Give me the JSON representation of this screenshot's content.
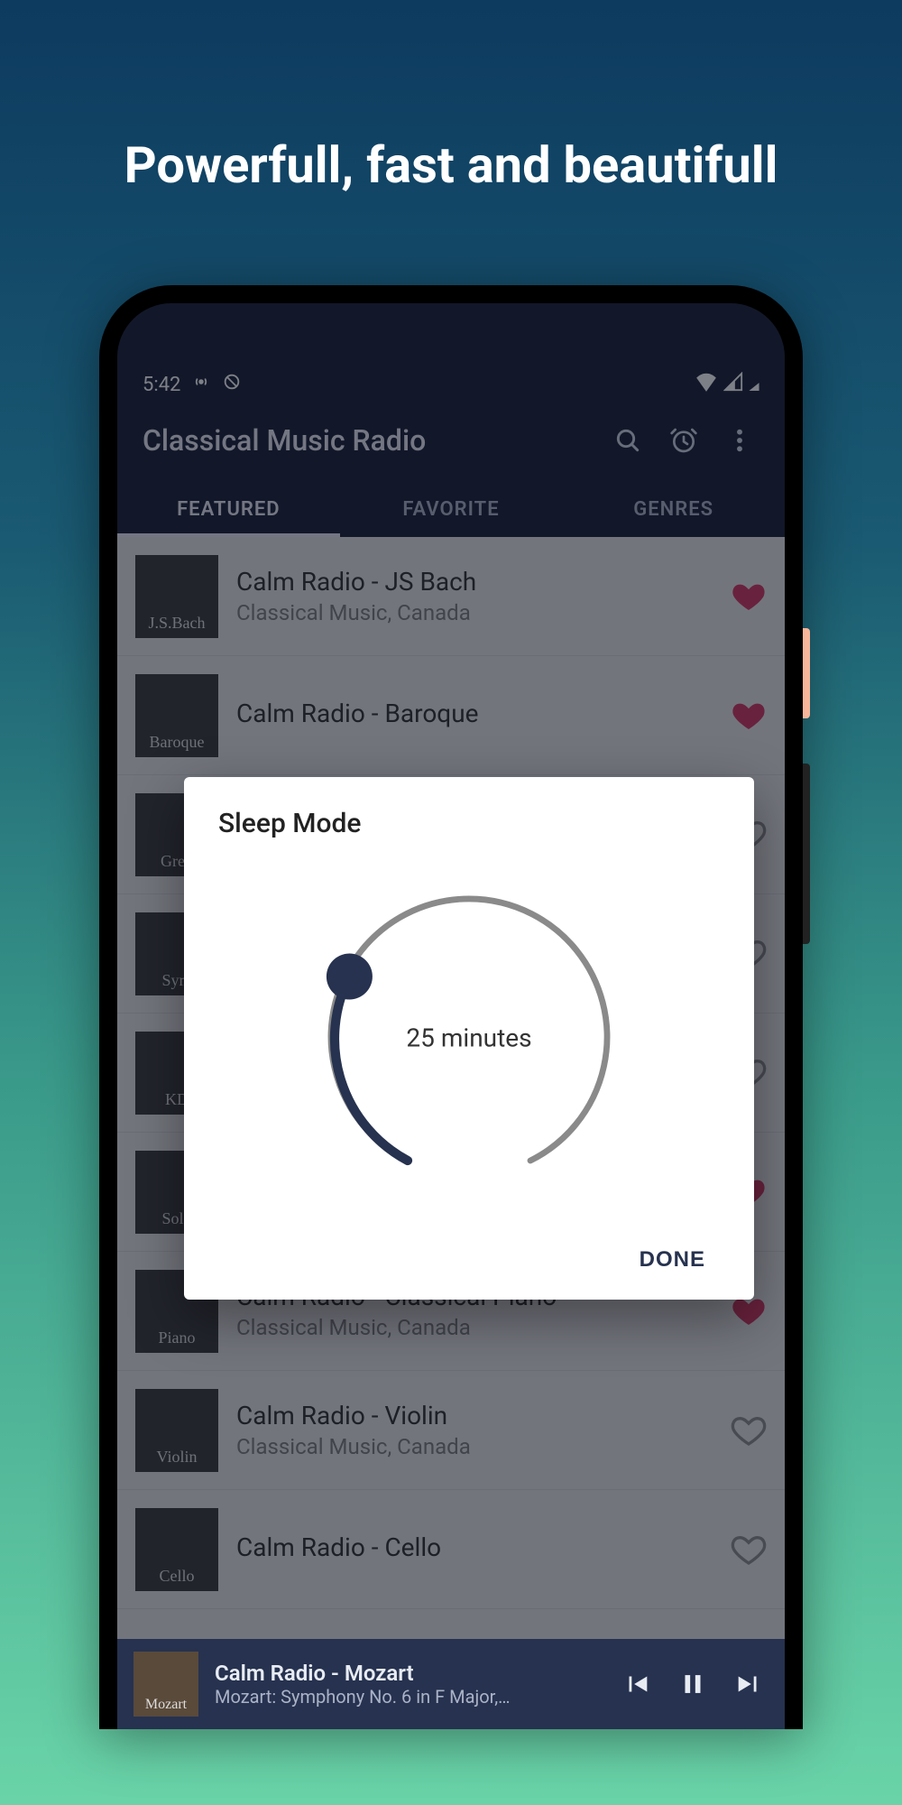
{
  "headline": "Powerfull, fast and beautifull",
  "status": {
    "time": "5:42",
    "icons_left": [
      "broadcast-icon",
      "no-location-icon"
    ],
    "icons_right": [
      "wifi-icon",
      "signal-icon",
      "battery-icon"
    ]
  },
  "app": {
    "title": "Classical Music Radio",
    "actions": [
      "search",
      "alarm",
      "more"
    ]
  },
  "tabs": [
    {
      "label": "FEATURED",
      "active": true
    },
    {
      "label": "FAVORITE",
      "active": false
    },
    {
      "label": "GENRES",
      "active": false
    }
  ],
  "stations": [
    {
      "thumb": "J.S.Bach",
      "title": "Calm Radio - JS Bach",
      "sub": "Classical Music, Canada",
      "fav": true
    },
    {
      "thumb": "Baroque",
      "title": "Calm Radio - Baroque",
      "sub": "",
      "fav": true
    },
    {
      "thumb": "Greg",
      "title": "",
      "sub": "",
      "fav": false
    },
    {
      "thumb": "Sym",
      "title": "",
      "sub": "",
      "fav": false
    },
    {
      "thumb": "KD",
      "title": "",
      "sub": "",
      "fav": false
    },
    {
      "thumb": "Solo",
      "title": "",
      "sub": "",
      "fav": true
    },
    {
      "thumb": "Piano",
      "title": "Calm Radio - Classical Piano",
      "sub": "Classical Music, Canada",
      "fav": true
    },
    {
      "thumb": "Violin",
      "title": "Calm Radio - Violin",
      "sub": "Classical Music, Canada",
      "fav": false
    },
    {
      "thumb": "Cello",
      "title": "Calm Radio - Cello",
      "sub": "",
      "fav": false
    }
  ],
  "dialog": {
    "title": "Sleep Mode",
    "value_label": "25 minutes",
    "done": "DONE"
  },
  "player": {
    "thumb": "Mozart",
    "title": "Calm Radio - Mozart",
    "sub": "Mozart: Symphony No. 6 in F Major,…"
  },
  "colors": {
    "fav": "#d02f5a",
    "unfav": "#8a8a8a",
    "accent": "#26324f"
  }
}
